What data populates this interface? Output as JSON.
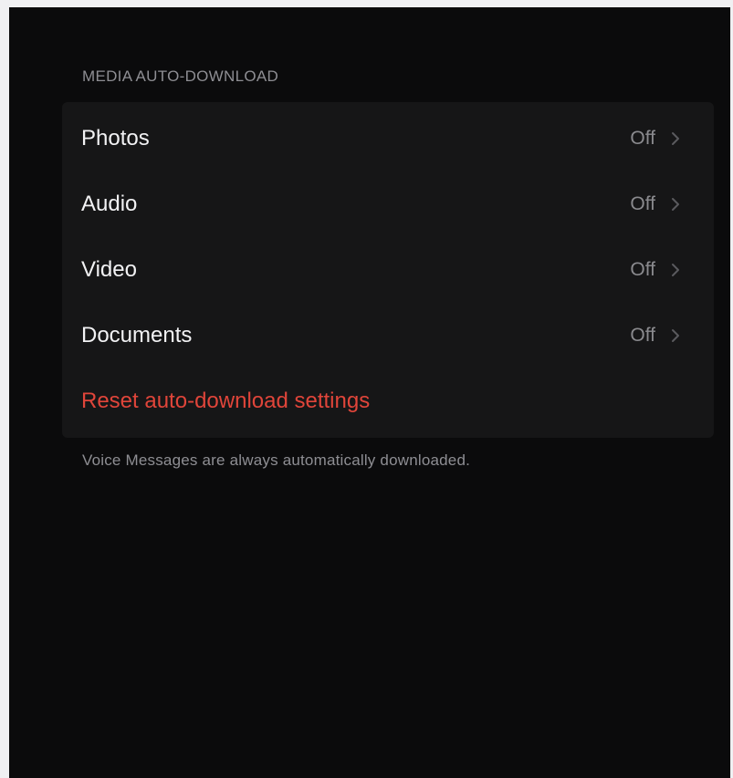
{
  "section": {
    "header": "MEDIA AUTO-DOWNLOAD",
    "rows": [
      {
        "label": "Photos",
        "value": "Off"
      },
      {
        "label": "Audio",
        "value": "Off"
      },
      {
        "label": "Video",
        "value": "Off"
      },
      {
        "label": "Documents",
        "value": "Off"
      }
    ],
    "reset_label": "Reset auto-download settings",
    "footer": "Voice Messages are always automatically downloaded."
  },
  "colors": {
    "background": "#0b0b0c",
    "group_background": "#161617",
    "destructive": "#e0453a",
    "secondary_text": "#8e8e93"
  },
  "icons": {
    "disclosure": "chevron-right-icon"
  }
}
